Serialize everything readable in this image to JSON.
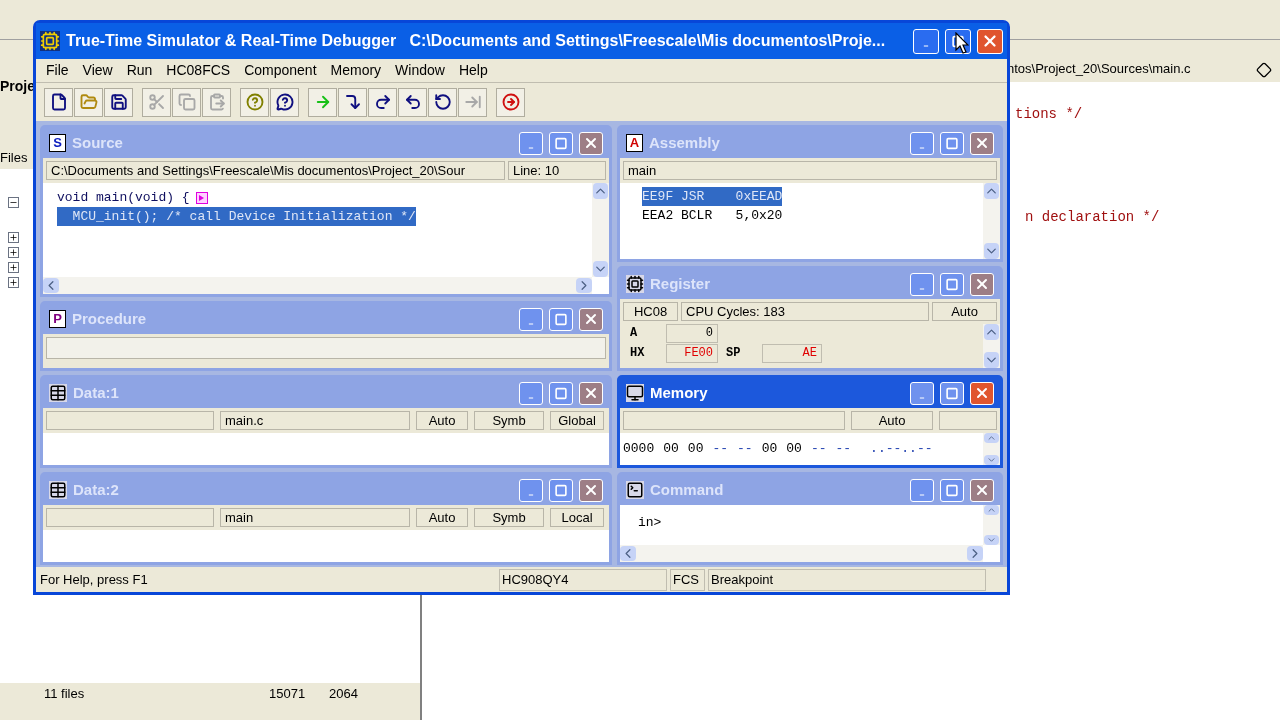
{
  "background_app": {
    "project_tab": "Proje",
    "files_tab": "Files",
    "editor_path": "ntos\\Project_20\\Sources\\main.c",
    "code_lines": [
      "tions */",
      "n declaration */"
    ],
    "file_count": "11 files",
    "column_3": "15071",
    "column_4": "2064"
  },
  "window": {
    "title": "True-Time Simulator & Real-Time Debugger   C:\\Documents and Settings\\Freescale\\Mis documentos\\Proje..."
  },
  "menu": [
    "File",
    "View",
    "Run",
    "HC08FCS",
    "Component",
    "Memory",
    "Window",
    "Help"
  ],
  "toolbar": [
    {
      "kind": "new",
      "disabled": false
    },
    {
      "kind": "open",
      "disabled": false
    },
    {
      "kind": "save",
      "disabled": false
    },
    {
      "kind": "cut",
      "disabled": true
    },
    {
      "kind": "copy",
      "disabled": true
    },
    {
      "kind": "paste",
      "disabled": true
    },
    {
      "kind": "help",
      "disabled": false
    },
    {
      "kind": "context-help",
      "disabled": false
    },
    {
      "kind": "start",
      "disabled": false
    },
    {
      "kind": "single-step",
      "disabled": false
    },
    {
      "kind": "step-over",
      "disabled": false
    },
    {
      "kind": "step-out",
      "disabled": false
    },
    {
      "kind": "assembly-step",
      "disabled": false
    },
    {
      "kind": "halt",
      "disabled": true
    },
    {
      "kind": "reset",
      "disabled": false
    }
  ],
  "left_column": [
    {
      "kind": "source",
      "title": "Source",
      "icon_letter": "S",
      "active": false,
      "path": "C:\\Documents and Settings\\Freescale\\Mis documentos\\Project_20\\Sour",
      "line": "Line: 10",
      "code": [
        {
          "text": "void main(void) {",
          "selected": false,
          "breakpoint": true
        },
        {
          "text": "  MCU_init(); /* call Device Initialization */",
          "selected": true,
          "breakpoint": false
        }
      ]
    },
    {
      "kind": "procedure",
      "title": "Procedure",
      "icon_letter": "P",
      "active": false
    },
    {
      "kind": "data",
      "title": "Data:1",
      "active": false,
      "scope": "main.c",
      "mode": "Auto",
      "format": "Symb",
      "range": "Global"
    },
    {
      "kind": "data",
      "title": "Data:2",
      "active": false,
      "scope": "main",
      "mode": "Auto",
      "format": "Symb",
      "range": "Local"
    }
  ],
  "right_column": [
    {
      "kind": "assembly",
      "title": "Assembly",
      "icon_letter": "A",
      "active": false,
      "header": "main",
      "lines": [
        {
          "address": "EE9F",
          "mnemonic": "JSR",
          "operand": "0xEEAD",
          "selected": true
        },
        {
          "address": "EEA2",
          "mnemonic": "BCLR",
          "operand": "5,0x20",
          "selected": false
        }
      ]
    },
    {
      "kind": "register",
      "title": "Register",
      "active": false,
      "cpu": "HC08",
      "cycles": "CPU Cycles:  183",
      "mode": "Auto",
      "registers": [
        {
          "name": "A",
          "value": "0",
          "changed": false
        },
        {
          "name": "HX",
          "value": "FE00",
          "changed": true
        },
        {
          "name": "SP",
          "value": "AE",
          "changed": true
        }
      ]
    },
    {
      "kind": "memory",
      "title": "Memory",
      "active": true,
      "mode": "Auto",
      "address": "0000",
      "bytes": [
        {
          "text": "00",
          "defined": true
        },
        {
          "text": "00",
          "defined": true
        },
        {
          "text": "--",
          "defined": false
        },
        {
          "text": "--",
          "defined": false
        },
        {
          "text": "00",
          "defined": true
        },
        {
          "text": "00",
          "defined": true
        },
        {
          "text": "--",
          "defined": false
        },
        {
          "text": "--",
          "defined": false
        }
      ],
      "ascii": "..--..--"
    },
    {
      "kind": "command",
      "title": "Command",
      "active": false,
      "prompt": "in>"
    }
  ],
  "status_bar": {
    "help": "For Help, press F1",
    "target": "HC908QY4",
    "connection": "FCS",
    "state": "Breakpoint"
  }
}
